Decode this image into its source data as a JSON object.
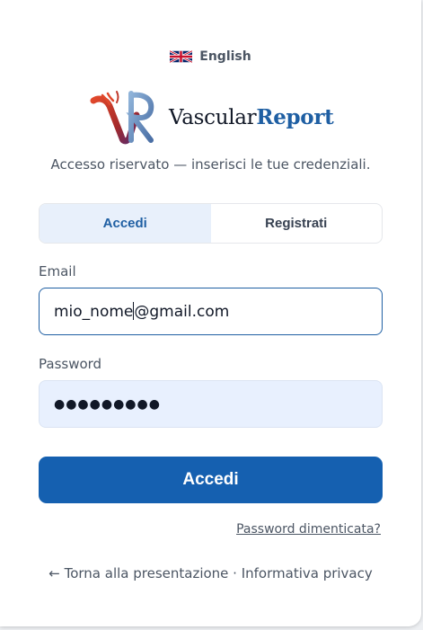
{
  "language": {
    "label": "English",
    "flag_icon": "uk-flag-icon"
  },
  "brand": {
    "name_part1": "Vascular",
    "name_part2": "Report",
    "accent_color": "#1f5fa3"
  },
  "subtitle": "Accesso riservato — inserisci le tue credenziali.",
  "tabs": [
    {
      "label": "Accedi",
      "active": true
    },
    {
      "label": "Registrati",
      "active": false
    }
  ],
  "form": {
    "email_label": "Email",
    "email_value_before_caret": "mio_nome",
    "email_value_after_caret": "@gmail.com",
    "password_label": "Password",
    "password_mask": "●●●●●●●●●",
    "submit_label": "Accedi",
    "forgot_label": "Password dimenticata?"
  },
  "footer": {
    "back_link": "← Torna alla presentazione",
    "separator": " · ",
    "privacy_link": "Informativa privacy"
  },
  "colors": {
    "primary": "#1560b0",
    "tab_active_bg": "#e8f0fb",
    "password_bg": "#e8f0fe"
  }
}
